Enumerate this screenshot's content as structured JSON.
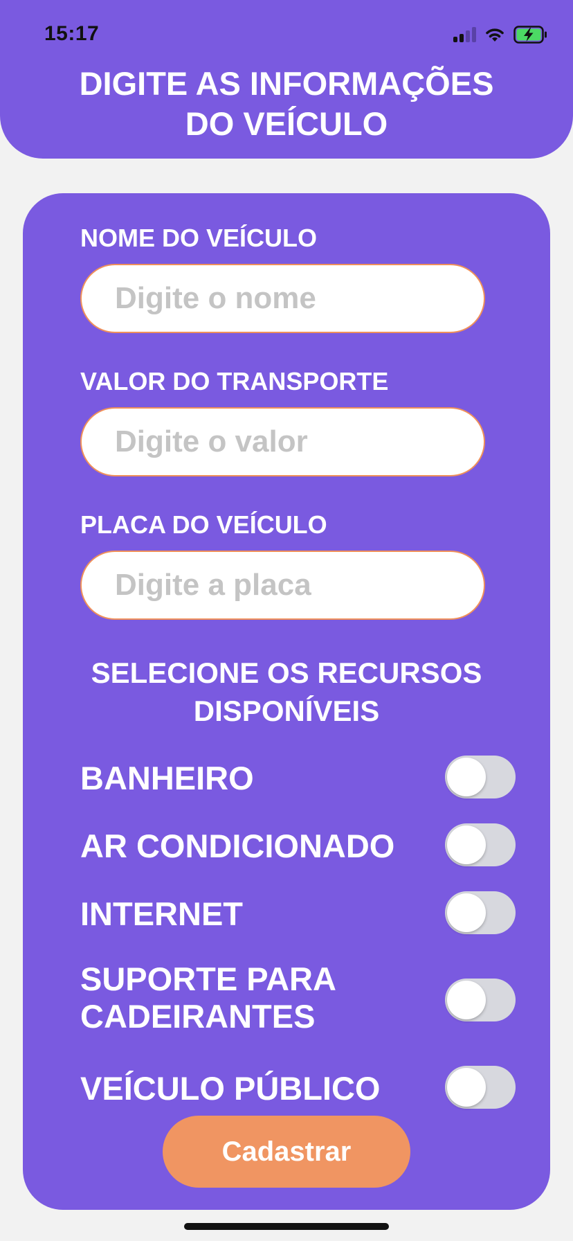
{
  "status_bar": {
    "time": "15:17",
    "icons": [
      "cellular-signal-icon",
      "wifi-icon",
      "battery-charging-icon"
    ],
    "battery_color": "#4cd964"
  },
  "header": {
    "title": "DIGITE AS INFORMAÇÕES\nDO VEÍCULO"
  },
  "form": {
    "fields": [
      {
        "label": "NOME DO VEÍCULO",
        "placeholder": "Digite o nome",
        "value": ""
      },
      {
        "label": "VALOR DO TRANSPORTE",
        "placeholder": "Digite o valor",
        "value": ""
      },
      {
        "label": "PLACA DO VEÍCULO",
        "placeholder": "Digite a placa",
        "value": ""
      }
    ],
    "features_title": "SELECIONE OS RECURSOS\nDISPONÍVEIS",
    "features": [
      {
        "label": "BANHEIRO",
        "enabled": false
      },
      {
        "label": "AR CONDICIONADO",
        "enabled": false
      },
      {
        "label": "INTERNET",
        "enabled": false
      },
      {
        "label": "SUPORTE PARA\nCADEIRANTES",
        "enabled": false
      },
      {
        "label": "VEÍCULO PÚBLICO",
        "enabled": false
      }
    ],
    "submit_label": "Cadastrar"
  },
  "colors": {
    "primary": "#7a5ae0",
    "accent": "#f09562",
    "background": "#f2f2f2",
    "toggle_off": "#d7d8de"
  }
}
